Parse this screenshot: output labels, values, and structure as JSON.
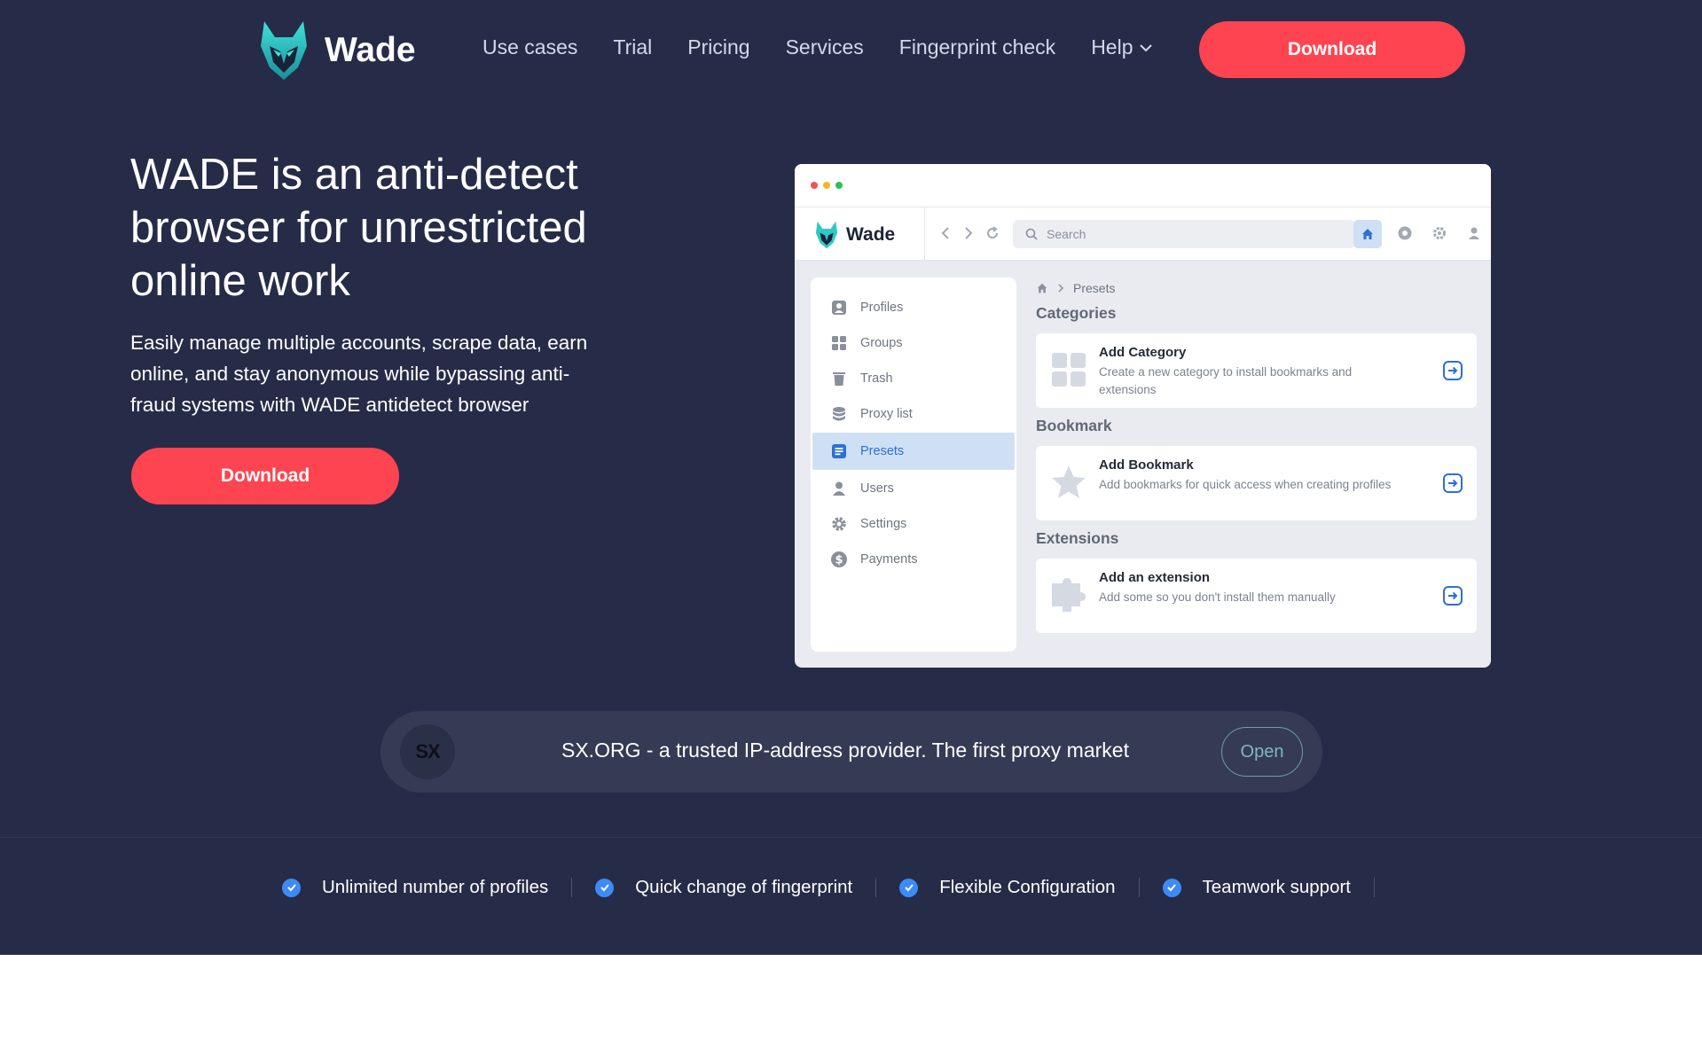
{
  "header": {
    "brand": "Wade",
    "nav": [
      "Use cases",
      "Trial",
      "Pricing",
      "Services",
      "Fingerprint check",
      "Help"
    ],
    "download_label": "Download"
  },
  "hero": {
    "title": "WADE is an anti-detect browser for unrestricted online work",
    "subtitle": "Easily manage multiple accounts, scrape data, earn online, and stay anonymous while bypassing anti-fraud systems with WADE antidetect browser",
    "download_label": "Download"
  },
  "app": {
    "brand": "Wade",
    "search_placeholder": "Search",
    "sidebar": [
      {
        "label": "Profiles",
        "icon": "profile-icon"
      },
      {
        "label": "Groups",
        "icon": "groups-icon"
      },
      {
        "label": "Trash",
        "icon": "trash-icon"
      },
      {
        "label": "Proxy list",
        "icon": "database-icon"
      },
      {
        "label": "Presets",
        "icon": "presets-icon",
        "active": true
      },
      {
        "label": "Users",
        "icon": "user-icon"
      },
      {
        "label": "Settings",
        "icon": "gear-icon"
      },
      {
        "label": "Payments",
        "icon": "dollar-icon"
      }
    ],
    "breadcrumb": "Presets",
    "sections": [
      {
        "title": "Categories",
        "card_title": "Add Category",
        "card_desc": "Create a new category to install bookmarks and extensions"
      },
      {
        "title": "Bookmark",
        "card_title": "Add Bookmark",
        "card_desc": "Add bookmarks for quick access when creating profiles"
      },
      {
        "title": "Extensions",
        "card_title": "Add an extension",
        "card_desc": "Add some so you don't install them manually"
      }
    ]
  },
  "promo": {
    "logo": "SX",
    "text": "SX.ORG - a trusted IP-address provider. The first proxy market",
    "open_label": "Open"
  },
  "features": [
    "Unlimited number of profiles",
    "Quick change of fingerprint",
    "Flexible Configuration",
    "Teamwork support"
  ],
  "colors": {
    "background": "#262c47",
    "accent": "#ff4451",
    "check": "#3d8bf6",
    "active": "#cfe0f5"
  }
}
